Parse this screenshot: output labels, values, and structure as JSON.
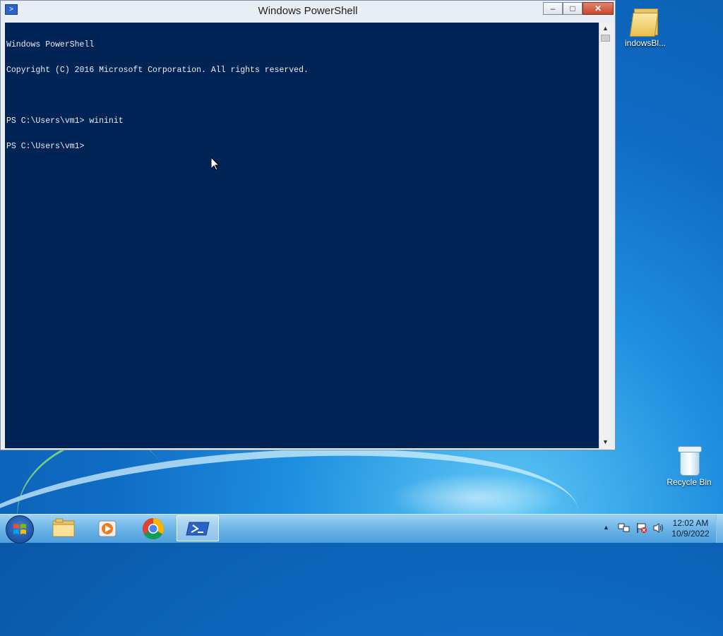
{
  "window": {
    "title": "Windows PowerShell",
    "controls": {
      "minimize": "–",
      "maximize": "□",
      "close": "✕"
    }
  },
  "console": {
    "lines": [
      "Windows PowerShell",
      "Copyright (C) 2016 Microsoft Corporation. All rights reserved.",
      "",
      "PS C:\\Users\\vm1> wininit",
      "PS C:\\Users\\vm1>"
    ],
    "background": "#012456",
    "foreground": "#eeedf0"
  },
  "desktop": {
    "icons": [
      {
        "label": "indowsBl...",
        "icon": "folder-icon"
      },
      {
        "label": "Recycle Bin",
        "icon": "recycle-bin-icon"
      }
    ]
  },
  "taskbar": {
    "start_icon": "windows-logo-icon",
    "pinned": [
      {
        "name": "file-explorer",
        "icon": "folder-icon"
      },
      {
        "name": "media-player",
        "icon": "media-player-icon"
      },
      {
        "name": "chrome",
        "icon": "chrome-icon"
      },
      {
        "name": "powershell",
        "icon": "powershell-icon",
        "active": true
      }
    ],
    "tray": {
      "overflow_icon": "▲",
      "network_icon": "network-icon",
      "action_center_icon": "flag-icon",
      "volume_icon": "volume-icon",
      "time": "12:02 AM",
      "date": "10/9/2022"
    }
  }
}
